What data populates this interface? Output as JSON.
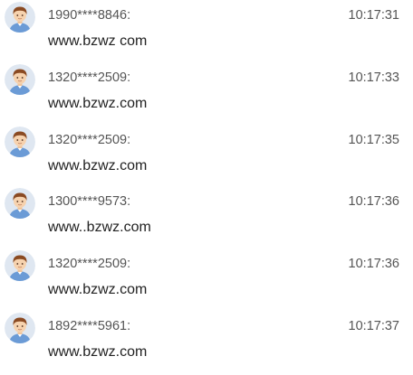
{
  "messages": [
    {
      "sender": "1990****8846:",
      "time": "10:17:31",
      "text": "www.bzwz com"
    },
    {
      "sender": "1320****2509:",
      "time": "10:17:33",
      "text": "www.bzwz.com"
    },
    {
      "sender": "1320****2509:",
      "time": "10:17:35",
      "text": "www.bzwz.com"
    },
    {
      "sender": "1300****9573:",
      "time": "10:17:36",
      "text": "www..bzwz.com"
    },
    {
      "sender": "1320****2509:",
      "time": "10:17:36",
      "text": "www.bzwz.com"
    },
    {
      "sender": "1892****5961:",
      "time": "10:17:37",
      "text": "www.bzwz.com"
    }
  ],
  "colors": {
    "avatar_bg": "#dfe7f1",
    "hair": "#8a4a22",
    "skin": "#f6d2ae",
    "shirt": "#6b9bd6",
    "sender_text": "#555555",
    "message_text": "#222222"
  },
  "icons": {
    "avatar": "user-avatar-icon"
  }
}
